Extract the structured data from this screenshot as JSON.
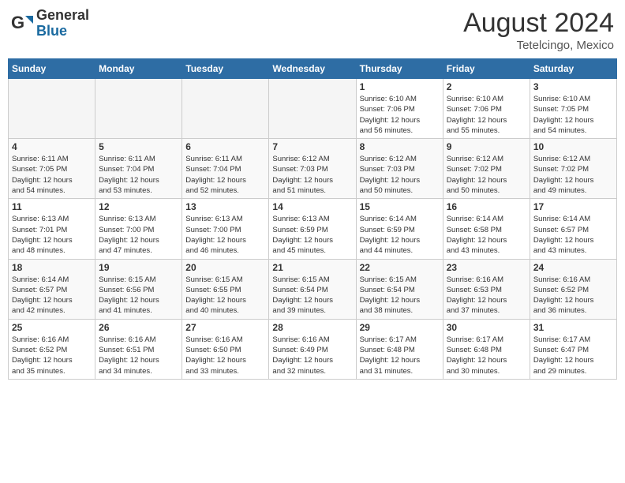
{
  "header": {
    "logo_general": "General",
    "logo_blue": "Blue",
    "month_year": "August 2024",
    "location": "Tetelcingo, Mexico"
  },
  "weekdays": [
    "Sunday",
    "Monday",
    "Tuesday",
    "Wednesday",
    "Thursday",
    "Friday",
    "Saturday"
  ],
  "weeks": [
    [
      {
        "num": "",
        "info": ""
      },
      {
        "num": "",
        "info": ""
      },
      {
        "num": "",
        "info": ""
      },
      {
        "num": "",
        "info": ""
      },
      {
        "num": "1",
        "info": "Sunrise: 6:10 AM\nSunset: 7:06 PM\nDaylight: 12 hours\nand 56 minutes."
      },
      {
        "num": "2",
        "info": "Sunrise: 6:10 AM\nSunset: 7:06 PM\nDaylight: 12 hours\nand 55 minutes."
      },
      {
        "num": "3",
        "info": "Sunrise: 6:10 AM\nSunset: 7:05 PM\nDaylight: 12 hours\nand 54 minutes."
      }
    ],
    [
      {
        "num": "4",
        "info": "Sunrise: 6:11 AM\nSunset: 7:05 PM\nDaylight: 12 hours\nand 54 minutes."
      },
      {
        "num": "5",
        "info": "Sunrise: 6:11 AM\nSunset: 7:04 PM\nDaylight: 12 hours\nand 53 minutes."
      },
      {
        "num": "6",
        "info": "Sunrise: 6:11 AM\nSunset: 7:04 PM\nDaylight: 12 hours\nand 52 minutes."
      },
      {
        "num": "7",
        "info": "Sunrise: 6:12 AM\nSunset: 7:03 PM\nDaylight: 12 hours\nand 51 minutes."
      },
      {
        "num": "8",
        "info": "Sunrise: 6:12 AM\nSunset: 7:03 PM\nDaylight: 12 hours\nand 50 minutes."
      },
      {
        "num": "9",
        "info": "Sunrise: 6:12 AM\nSunset: 7:02 PM\nDaylight: 12 hours\nand 50 minutes."
      },
      {
        "num": "10",
        "info": "Sunrise: 6:12 AM\nSunset: 7:02 PM\nDaylight: 12 hours\nand 49 minutes."
      }
    ],
    [
      {
        "num": "11",
        "info": "Sunrise: 6:13 AM\nSunset: 7:01 PM\nDaylight: 12 hours\nand 48 minutes."
      },
      {
        "num": "12",
        "info": "Sunrise: 6:13 AM\nSunset: 7:00 PM\nDaylight: 12 hours\nand 47 minutes."
      },
      {
        "num": "13",
        "info": "Sunrise: 6:13 AM\nSunset: 7:00 PM\nDaylight: 12 hours\nand 46 minutes."
      },
      {
        "num": "14",
        "info": "Sunrise: 6:13 AM\nSunset: 6:59 PM\nDaylight: 12 hours\nand 45 minutes."
      },
      {
        "num": "15",
        "info": "Sunrise: 6:14 AM\nSunset: 6:59 PM\nDaylight: 12 hours\nand 44 minutes."
      },
      {
        "num": "16",
        "info": "Sunrise: 6:14 AM\nSunset: 6:58 PM\nDaylight: 12 hours\nand 43 minutes."
      },
      {
        "num": "17",
        "info": "Sunrise: 6:14 AM\nSunset: 6:57 PM\nDaylight: 12 hours\nand 43 minutes."
      }
    ],
    [
      {
        "num": "18",
        "info": "Sunrise: 6:14 AM\nSunset: 6:57 PM\nDaylight: 12 hours\nand 42 minutes."
      },
      {
        "num": "19",
        "info": "Sunrise: 6:15 AM\nSunset: 6:56 PM\nDaylight: 12 hours\nand 41 minutes."
      },
      {
        "num": "20",
        "info": "Sunrise: 6:15 AM\nSunset: 6:55 PM\nDaylight: 12 hours\nand 40 minutes."
      },
      {
        "num": "21",
        "info": "Sunrise: 6:15 AM\nSunset: 6:54 PM\nDaylight: 12 hours\nand 39 minutes."
      },
      {
        "num": "22",
        "info": "Sunrise: 6:15 AM\nSunset: 6:54 PM\nDaylight: 12 hours\nand 38 minutes."
      },
      {
        "num": "23",
        "info": "Sunrise: 6:16 AM\nSunset: 6:53 PM\nDaylight: 12 hours\nand 37 minutes."
      },
      {
        "num": "24",
        "info": "Sunrise: 6:16 AM\nSunset: 6:52 PM\nDaylight: 12 hours\nand 36 minutes."
      }
    ],
    [
      {
        "num": "25",
        "info": "Sunrise: 6:16 AM\nSunset: 6:52 PM\nDaylight: 12 hours\nand 35 minutes."
      },
      {
        "num": "26",
        "info": "Sunrise: 6:16 AM\nSunset: 6:51 PM\nDaylight: 12 hours\nand 34 minutes."
      },
      {
        "num": "27",
        "info": "Sunrise: 6:16 AM\nSunset: 6:50 PM\nDaylight: 12 hours\nand 33 minutes."
      },
      {
        "num": "28",
        "info": "Sunrise: 6:16 AM\nSunset: 6:49 PM\nDaylight: 12 hours\nand 32 minutes."
      },
      {
        "num": "29",
        "info": "Sunrise: 6:17 AM\nSunset: 6:48 PM\nDaylight: 12 hours\nand 31 minutes."
      },
      {
        "num": "30",
        "info": "Sunrise: 6:17 AM\nSunset: 6:48 PM\nDaylight: 12 hours\nand 30 minutes."
      },
      {
        "num": "31",
        "info": "Sunrise: 6:17 AM\nSunset: 6:47 PM\nDaylight: 12 hours\nand 29 minutes."
      }
    ]
  ]
}
